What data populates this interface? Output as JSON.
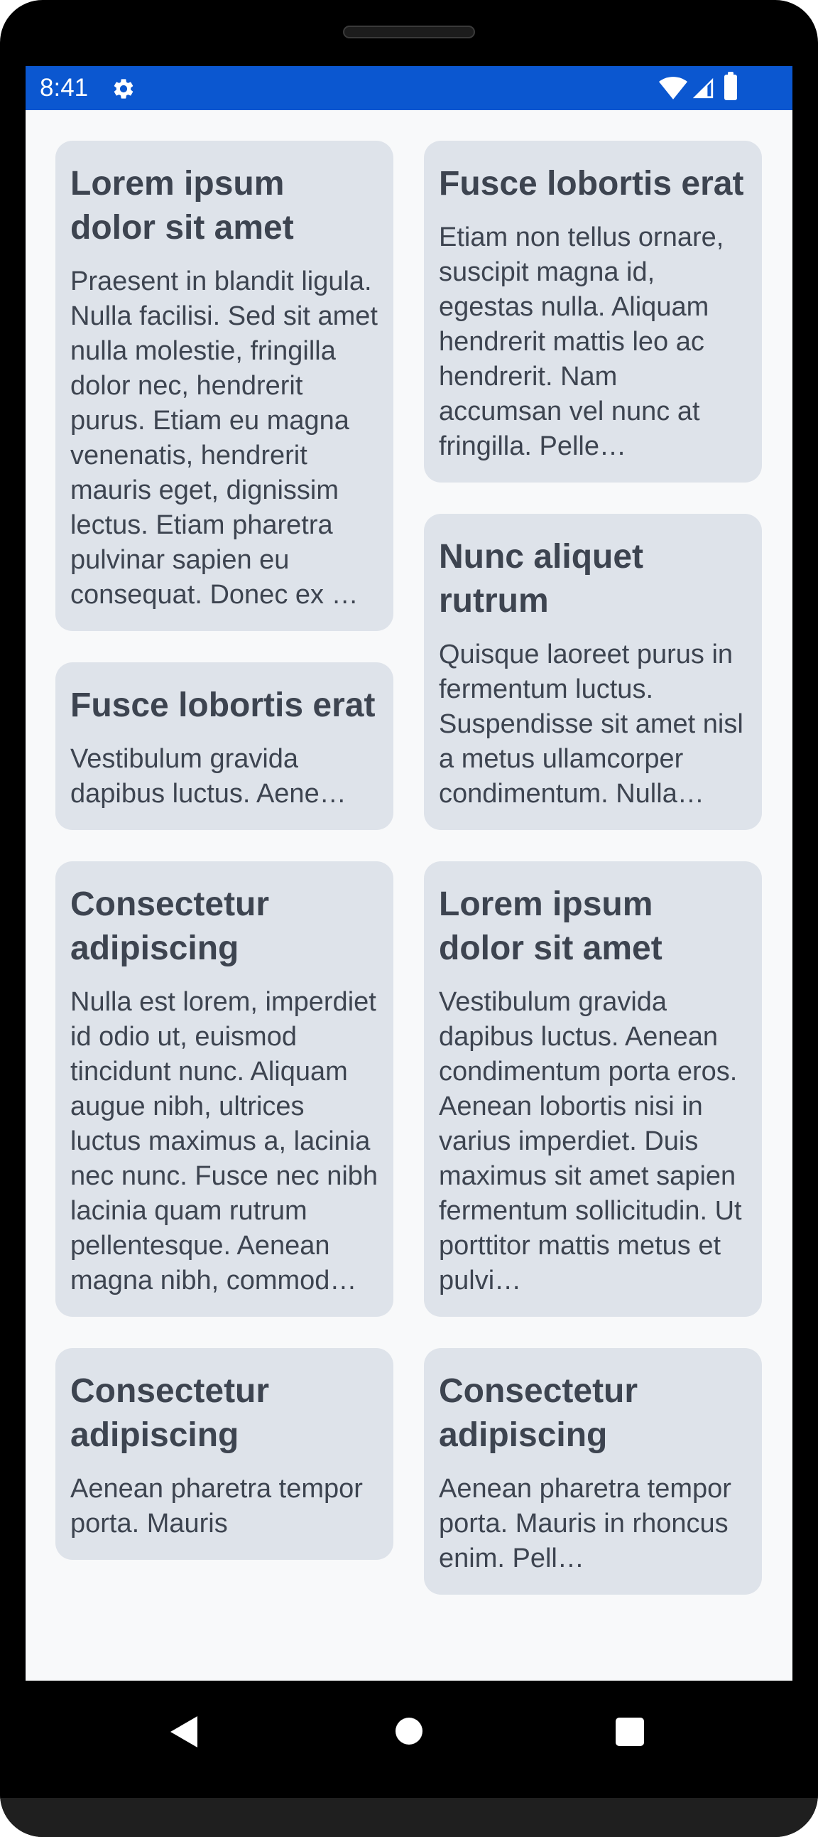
{
  "status_bar": {
    "time": "8:41",
    "background_color": "#0b57d0",
    "icons": [
      "gear-icon",
      "wifi-icon",
      "cell-signal-icon",
      "battery-icon"
    ]
  },
  "colors": {
    "card_background": "#dee3ea",
    "text": "#3d4450",
    "screen_background": "#f8f9fa"
  },
  "cards": {
    "left": [
      {
        "title": "Lorem ipsum dolor sit amet",
        "body": "Praesent in blandit ligula. Nulla facilisi. Sed sit amet nulla molestie, fringilla dolor nec, hendrerit purus. Etiam eu magna venenatis, hendrerit mauris eget, dignissim lectus. Etiam pharetra pulvinar sapien eu consequat. Donec ex …",
        "visible_lines": 11
      },
      {
        "title": "Fusce lobortis erat",
        "body": "Vestibulum gravida dapibus luctus. Aene…",
        "visible_lines": 2
      },
      {
        "title": "Consectetur adipiscing",
        "body": "Nulla est lorem, imperdiet id odio ut, euismod tincidunt nunc. Aliquam augue nibh, ultrices luctus maximus a, lacinia nec nunc. Fusce nec nibh lacinia quam rutrum pellentesque. Aenean magna nibh, commod…",
        "visible_lines": 10
      },
      {
        "title": "Consectetur adipiscing",
        "body": "Aenean pharetra tempor porta. Mauris",
        "visible_lines": 2
      }
    ],
    "right": [
      {
        "title": "Fusce lobortis erat",
        "body": "Etiam non tellus ornare, suscipit magna id, egestas nulla. Aliquam hendrerit mattis leo ac hendrerit. Nam accumsan vel nunc at fringilla. Pelle…",
        "visible_lines": 7
      },
      {
        "title": "Nunc aliquet rutrum",
        "body": "Quisque laoreet purus in fermentum luctus. Suspendisse sit amet nisl a metus ullamcorper condimentum. Nulla…",
        "visible_lines": 6
      },
      {
        "title": "Lorem ipsum dolor sit amet",
        "body": "Vestibulum gravida dapibus luctus. Aenean condimentum porta eros. Aenean lobortis nisi in varius imperdiet. Duis maximus sit amet sapien fermentum sollicitudin. Ut porttitor mattis metus et pulvi…",
        "visible_lines": 9
      },
      {
        "title": "Consectetur adipiscing",
        "body": "Aenean pharetra tempor porta. Mauris in rhoncus enim. Pell…",
        "visible_lines": 3
      }
    ]
  },
  "nav_bar": {
    "buttons": [
      "back-icon",
      "home-icon",
      "recents-icon"
    ]
  }
}
